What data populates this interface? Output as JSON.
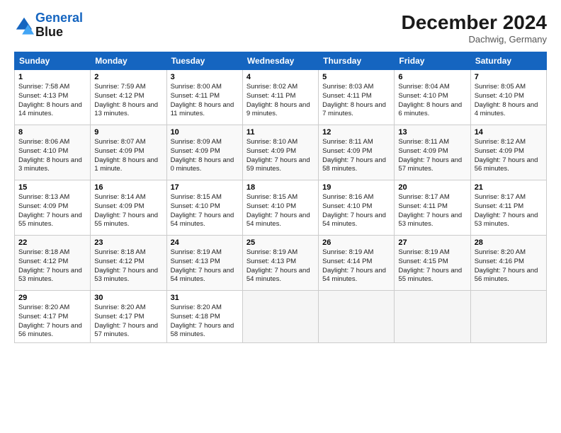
{
  "logo": {
    "line1": "General",
    "line2": "Blue"
  },
  "title": "December 2024",
  "location": "Dachwig, Germany",
  "weekdays": [
    "Sunday",
    "Monday",
    "Tuesday",
    "Wednesday",
    "Thursday",
    "Friday",
    "Saturday"
  ],
  "weeks": [
    [
      {
        "day": "1",
        "sunrise": "7:58 AM",
        "sunset": "4:13 PM",
        "daylight": "8 hours and 14 minutes."
      },
      {
        "day": "2",
        "sunrise": "7:59 AM",
        "sunset": "4:12 PM",
        "daylight": "8 hours and 13 minutes."
      },
      {
        "day": "3",
        "sunrise": "8:00 AM",
        "sunset": "4:11 PM",
        "daylight": "8 hours and 11 minutes."
      },
      {
        "day": "4",
        "sunrise": "8:02 AM",
        "sunset": "4:11 PM",
        "daylight": "8 hours and 9 minutes."
      },
      {
        "day": "5",
        "sunrise": "8:03 AM",
        "sunset": "4:11 PM",
        "daylight": "8 hours and 7 minutes."
      },
      {
        "day": "6",
        "sunrise": "8:04 AM",
        "sunset": "4:10 PM",
        "daylight": "8 hours and 6 minutes."
      },
      {
        "day": "7",
        "sunrise": "8:05 AM",
        "sunset": "4:10 PM",
        "daylight": "8 hours and 4 minutes."
      }
    ],
    [
      {
        "day": "8",
        "sunrise": "8:06 AM",
        "sunset": "4:10 PM",
        "daylight": "8 hours and 3 minutes."
      },
      {
        "day": "9",
        "sunrise": "8:07 AM",
        "sunset": "4:09 PM",
        "daylight": "8 hours and 1 minute."
      },
      {
        "day": "10",
        "sunrise": "8:09 AM",
        "sunset": "4:09 PM",
        "daylight": "8 hours and 0 minutes."
      },
      {
        "day": "11",
        "sunrise": "8:10 AM",
        "sunset": "4:09 PM",
        "daylight": "7 hours and 59 minutes."
      },
      {
        "day": "12",
        "sunrise": "8:11 AM",
        "sunset": "4:09 PM",
        "daylight": "7 hours and 58 minutes."
      },
      {
        "day": "13",
        "sunrise": "8:11 AM",
        "sunset": "4:09 PM",
        "daylight": "7 hours and 57 minutes."
      },
      {
        "day": "14",
        "sunrise": "8:12 AM",
        "sunset": "4:09 PM",
        "daylight": "7 hours and 56 minutes."
      }
    ],
    [
      {
        "day": "15",
        "sunrise": "8:13 AM",
        "sunset": "4:09 PM",
        "daylight": "7 hours and 55 minutes."
      },
      {
        "day": "16",
        "sunrise": "8:14 AM",
        "sunset": "4:09 PM",
        "daylight": "7 hours and 55 minutes."
      },
      {
        "day": "17",
        "sunrise": "8:15 AM",
        "sunset": "4:10 PM",
        "daylight": "7 hours and 54 minutes."
      },
      {
        "day": "18",
        "sunrise": "8:15 AM",
        "sunset": "4:10 PM",
        "daylight": "7 hours and 54 minutes."
      },
      {
        "day": "19",
        "sunrise": "8:16 AM",
        "sunset": "4:10 PM",
        "daylight": "7 hours and 54 minutes."
      },
      {
        "day": "20",
        "sunrise": "8:17 AM",
        "sunset": "4:11 PM",
        "daylight": "7 hours and 53 minutes."
      },
      {
        "day": "21",
        "sunrise": "8:17 AM",
        "sunset": "4:11 PM",
        "daylight": "7 hours and 53 minutes."
      }
    ],
    [
      {
        "day": "22",
        "sunrise": "8:18 AM",
        "sunset": "4:12 PM",
        "daylight": "7 hours and 53 minutes."
      },
      {
        "day": "23",
        "sunrise": "8:18 AM",
        "sunset": "4:12 PM",
        "daylight": "7 hours and 53 minutes."
      },
      {
        "day": "24",
        "sunrise": "8:19 AM",
        "sunset": "4:13 PM",
        "daylight": "7 hours and 54 minutes."
      },
      {
        "day": "25",
        "sunrise": "8:19 AM",
        "sunset": "4:13 PM",
        "daylight": "7 hours and 54 minutes."
      },
      {
        "day": "26",
        "sunrise": "8:19 AM",
        "sunset": "4:14 PM",
        "daylight": "7 hours and 54 minutes."
      },
      {
        "day": "27",
        "sunrise": "8:19 AM",
        "sunset": "4:15 PM",
        "daylight": "7 hours and 55 minutes."
      },
      {
        "day": "28",
        "sunrise": "8:20 AM",
        "sunset": "4:16 PM",
        "daylight": "7 hours and 56 minutes."
      }
    ],
    [
      {
        "day": "29",
        "sunrise": "8:20 AM",
        "sunset": "4:17 PM",
        "daylight": "7 hours and 56 minutes."
      },
      {
        "day": "30",
        "sunrise": "8:20 AM",
        "sunset": "4:17 PM",
        "daylight": "7 hours and 57 minutes."
      },
      {
        "day": "31",
        "sunrise": "8:20 AM",
        "sunset": "4:18 PM",
        "daylight": "7 hours and 58 minutes."
      },
      null,
      null,
      null,
      null
    ]
  ]
}
